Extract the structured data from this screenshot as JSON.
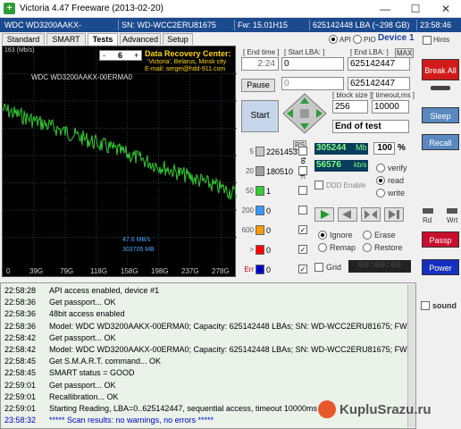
{
  "window": {
    "title": "Victoria 4.47  Freeware (2013-02-20)",
    "icon_letter": "+",
    "minimize": "—",
    "maximize": "☐",
    "close": "✕"
  },
  "infobar": {
    "model": "WDC WD3200AAKX-00ERMA0",
    "serial": "SN: WD-WCC2ERU81675",
    "firmware": "Fw: 15.01H15",
    "lba": "625142448 LBA (~298 GB)",
    "clock": "23:58:46"
  },
  "tabs": [
    "Standard",
    "SMART",
    "Tests",
    "Advanced",
    "Setup"
  ],
  "api": {
    "api_label": "API",
    "pio_label": "PIO",
    "device_label": "Device 1",
    "hints_label": "Hints"
  },
  "graph": {
    "speed_label": "163 (Mb/s)",
    "model_label": "WDC WD3200AAKX-00ERMA0",
    "center_lines": [
      "Data Recovery Center:",
      "'Victoria', Belarus, Minsk city",
      "E-mail: sergei@hdd-911.com"
    ],
    "sel_minus": "-",
    "sel_value": "6",
    "sel_plus": "+",
    "x_ticks": [
      "0",
      "39G",
      "79G",
      "118G",
      "158G",
      "198G",
      "237G",
      "278G"
    ],
    "speed_readout": "47.6 MB/s",
    "bytes_readout": "303705 MB"
  },
  "controls": {
    "end_time_label": "[ End time ]",
    "end_time_value": "2:24",
    "start_lba_label": "[ Start LBA: ]",
    "start_lba_value": "0",
    "end_lba_label": "[ End LBA: ]",
    "end_lba_max": "MAX",
    "end_lba_value": "625142447",
    "end_lba_value2": "625142447",
    "cur_value": "0",
    "pause": "Pause",
    "start": "Start",
    "block_size_label": "[ block size ]",
    "block_size": "256",
    "timeout_label": "[ timeout,ms ]",
    "timeout": "10000",
    "end_mode": "End of test",
    "rs": "RS",
    "to_log": "to log:"
  },
  "counters": [
    {
      "ms": "5",
      "count": "2261453",
      "color": "#c8c8c8"
    },
    {
      "ms": "20",
      "count": "180510",
      "color": "#a0a0a0"
    },
    {
      "ms": "50",
      "count": "1",
      "color": "#33cc33"
    },
    {
      "ms": "200",
      "count": "0",
      "color": "#3399ff"
    },
    {
      "ms": "600",
      "count": "0",
      "color": "#ff9900"
    },
    {
      "ms": ">",
      "count": "0",
      "color": "#ff0000"
    },
    {
      "ms": "Err",
      "count": "0",
      "color": "#0000cc"
    }
  ],
  "stats": {
    "mb": "305244",
    "mb_unit": "Mb",
    "percent": "100",
    "percent_unit": "%",
    "speed": "56576",
    "speed_unit": "kb/s",
    "ddd": "DDD Enable"
  },
  "modes": {
    "verify": "verify",
    "read": "read",
    "write": "write"
  },
  "actions": {
    "ignore": "Ignore",
    "erase": "Erase",
    "remap": "Remap",
    "restore": "Restore"
  },
  "grid_label": "Grid",
  "timer": "00:00:00",
  "side": {
    "break_all": "Break All",
    "sleep": "Sleep",
    "recall": "Recall",
    "rd": "Rd",
    "wrt": "Wrt",
    "passp": "Passp",
    "power": "Power",
    "sound": "sound"
  },
  "log": [
    {
      "t": "22:58:28",
      "m": "API access enabled, device #1",
      "c": "#000"
    },
    {
      "t": "22:58:36",
      "m": "Get passport... OK",
      "c": "#000"
    },
    {
      "t": "22:58:36",
      "m": "48bit access enabled",
      "c": "#000"
    },
    {
      "t": "22:58:36",
      "m": "Model: WDC WD3200AAKX-00ERMA0; Capacity: 625142448 LBAs; SN: WD-WCC2ERU81675; FW: 15.0",
      "c": "#000"
    },
    {
      "t": "22:58:42",
      "m": "Get passport... OK",
      "c": "#000"
    },
    {
      "t": "22:58:42",
      "m": "Model: WDC WD3200AAKX-00ERMA0; Capacity: 625142448 LBAs; SN: WD-WCC2ERU81675; FW: 15.0",
      "c": "#000"
    },
    {
      "t": "22:58:45",
      "m": "Get S.M.A.R.T. command... OK",
      "c": "#000"
    },
    {
      "t": "22:58:45",
      "m": "SMART status = GOOD",
      "c": "#000"
    },
    {
      "t": "22:59:01",
      "m": "Get passport... OK",
      "c": "#000"
    },
    {
      "t": "22:59:01",
      "m": "Recallibration... OK",
      "c": "#000"
    },
    {
      "t": "22:59:01",
      "m": "Starting Reading, LBA=0..625142447, sequential access, timeout 10000ms",
      "c": "#000"
    },
    {
      "t": "23:58:32",
      "m": "***** Scan results: no warnings, no errors *****",
      "c": "#0000cc"
    }
  ],
  "watermark": "KupluSrazu.ru",
  "colors": {
    "infobar": "#1c4a8f",
    "break": "#d11b1b",
    "passp": "#c8102e",
    "power": "#1530c0",
    "graph_line": "#33cc33"
  }
}
